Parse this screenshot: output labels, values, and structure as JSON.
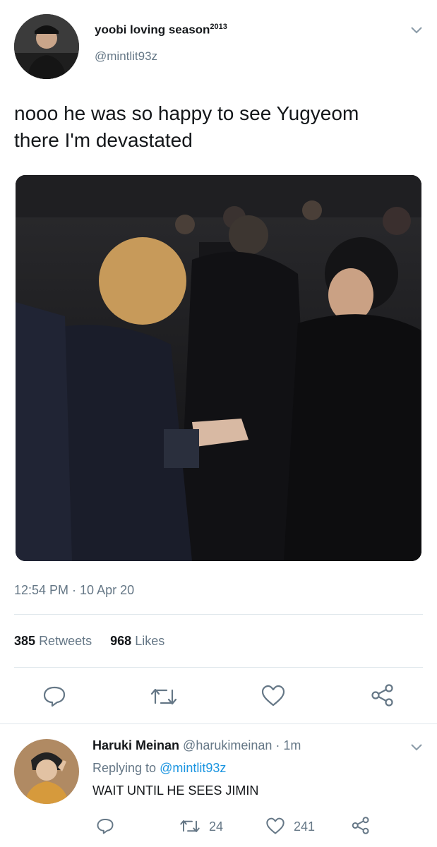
{
  "tweet": {
    "display_name": "yoobi loving season",
    "name_suffix": "2013",
    "handle": "@mintlit93z",
    "text_line1": "nooo he was so happy to see Yugyeom",
    "text_line2": "there I'm devastated",
    "time": "12:54 PM · 10 Apr 20",
    "retweets_count": "385",
    "retweets_label": "Retweets",
    "likes_count": "968",
    "likes_label": "Likes"
  },
  "reply": {
    "display_name": "Haruki Meinan",
    "handle": "@harukimeinan",
    "age": "· 1m",
    "replying_prefix": "Replying to",
    "replying_to": "@mintlit93z",
    "text": "WAIT UNTIL HE SEES JIMIN",
    "retweets": "24",
    "likes": "241"
  },
  "icons": {
    "reply": "reply-icon",
    "retweet": "retweet-icon",
    "like": "heart-icon",
    "share": "share-icon",
    "menu": "chevron-down-icon"
  },
  "colors": {
    "link": "#1b95e0",
    "muted": "#657786",
    "divider": "#e1e8ed"
  }
}
